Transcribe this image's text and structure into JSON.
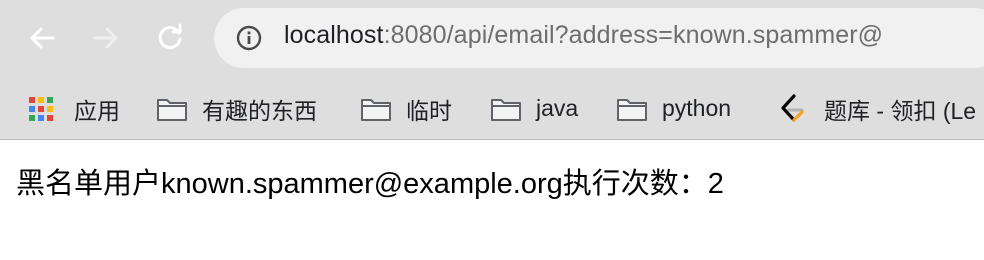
{
  "browser": {
    "nav": {
      "back_icon": "back-arrow-icon",
      "forward_icon": "forward-arrow-icon",
      "reload_icon": "reload-icon"
    },
    "address_bar": {
      "security_icon": "info-icon",
      "host": "localhost",
      "path": ":8080/api/email?address=known.spammer@"
    },
    "bookmarks": [
      {
        "label": "应用",
        "icon": "apps-grid-icon"
      },
      {
        "label": "有趣的东西",
        "icon": "folder-icon"
      },
      {
        "label": "临时",
        "icon": "folder-icon"
      },
      {
        "label": "java",
        "icon": "folder-icon"
      },
      {
        "label": "python",
        "icon": "folder-icon"
      },
      {
        "label": "题库 - 领扣 (Le",
        "icon": "leetcode-icon"
      }
    ]
  },
  "page": {
    "body_text": "黑名单用户known.spammer@example.org执行次数：2"
  },
  "colors": {
    "toolbar_bg": "#dedede",
    "omnibox_bg": "#f1f1f1",
    "url_host": "#202124",
    "url_rest": "#6d6d6d"
  }
}
